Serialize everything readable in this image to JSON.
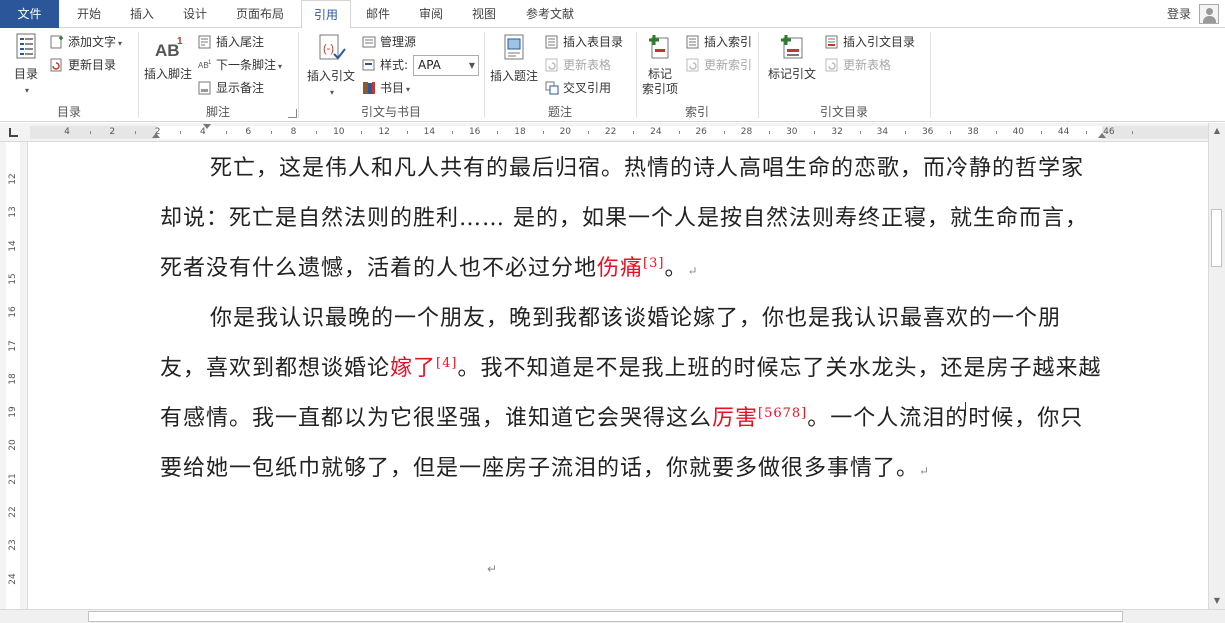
{
  "tabs": {
    "file": "文件",
    "home": "开始",
    "insert": "插入",
    "design": "设计",
    "layout": "页面布局",
    "references": "引用",
    "mailings": "邮件",
    "review": "审阅",
    "view": "视图",
    "bibliography": "参考文献"
  },
  "account": {
    "login": "登录"
  },
  "ribbon": {
    "toc": {
      "toc_button": "目录",
      "add_text": "添加文字",
      "update_toc": "更新目录",
      "group_label": "目录"
    },
    "footnotes": {
      "insert_footnote": "插入脚注",
      "insert_endnote": "插入尾注",
      "next_footnote": "下一条脚注",
      "show_notes": "显示备注",
      "group_label": "脚注"
    },
    "citations": {
      "insert_citation": "插入引文",
      "manage_sources": "管理源",
      "style_label": "样式:",
      "style_value": "APA",
      "bibliography": "书目",
      "group_label": "引文与书目"
    },
    "captions": {
      "insert_caption": "插入题注",
      "insert_table_of_figures": "插入表目录",
      "update_table": "更新表格",
      "cross_reference": "交叉引用",
      "group_label": "题注"
    },
    "index": {
      "mark_entry_line1": "标记",
      "mark_entry_line2": "索引项",
      "insert_index": "插入索引",
      "update_index": "更新索引",
      "group_label": "索引"
    },
    "toa": {
      "mark_citation": "标记引文",
      "insert_toa": "插入引文目录",
      "update_table": "更新表格",
      "group_label": "引文目录"
    }
  },
  "ruler": {
    "h_labels": [
      "4",
      "2",
      "2",
      "4",
      "6",
      "8",
      "10",
      "12",
      "14",
      "16",
      "18",
      "20",
      "22",
      "24",
      "26",
      "28",
      "30",
      "32",
      "34",
      "36",
      "38",
      "40",
      "44",
      "46"
    ],
    "v_labels": [
      "12",
      "13",
      "14",
      "15",
      "16",
      "17",
      "18",
      "19",
      "20",
      "21",
      "22",
      "23",
      "24"
    ]
  },
  "document": {
    "p1": {
      "text": "死亡，这是伟人和凡人共有的最后归宿。热情的诗人高唱生命的恋歌，而冷静的哲学家却说：死亡是自然法则的胜利…… 是的，如果一个人是按自然法则寿终正寝，就生命而言，死者没有什么遗憾，活着的人也不必过分地",
      "highlight": "伤痛",
      "ref": "[3]",
      "end": "。"
    },
    "p2": {
      "text_a": "你是我认识最晚的一个朋友，晚到我都该谈婚论嫁了，你也是我认识最喜欢的一个朋友，喜欢到都想谈婚论",
      "highlight_a": "嫁了",
      "ref_a": "[4]",
      "text_b": "。我不知道是不是我上班的时候忘了关水龙头，还是房子越来越有感情。我一直都以为它很坚强，谁知道它会哭得这么",
      "highlight_b": "厉害",
      "ref_b": "[5678]",
      "text_c": "。一个人流泪的时候，你只要给她一包纸巾就够了，但是一座房子流泪的话，你就要多做很多事情了。"
    },
    "para_mark": "↵"
  },
  "colors": {
    "file_tab": "#2b579a",
    "highlight": "#e81123"
  }
}
